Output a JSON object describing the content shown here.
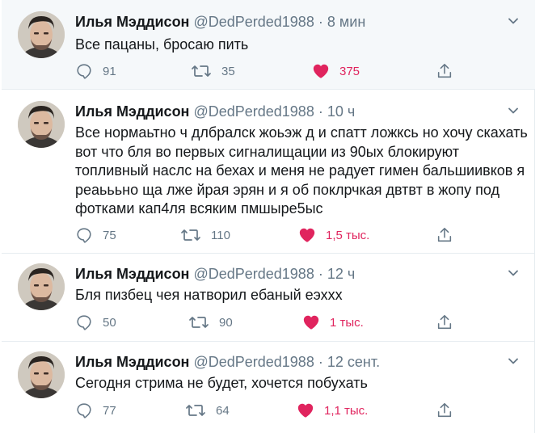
{
  "colors": {
    "like": "#e0245e",
    "muted": "#657786",
    "text": "#14171a",
    "highlight_bg": "#f5f8fa",
    "border": "#e6ecf0"
  },
  "icons": [
    "reply-icon",
    "retweet-icon",
    "heart-icon",
    "share-icon",
    "chevron-down-icon"
  ],
  "tweets": [
    {
      "name": "Илья Мэддисон",
      "handle": "@DedPerded1988",
      "sep": "·",
      "time": "8 мин",
      "text": "Все пацаны, бросаю пить",
      "replies": "91",
      "retweets": "35",
      "likes": "375"
    },
    {
      "name": "Илья Мэддисон",
      "handle": "@DedPerded1988",
      "sep": "·",
      "time": "10 ч",
      "text": "Все нормаьтно ч длбралск жоьэж д и спатт ложкс⁠ь но хочу скахать вот что бля во первых сигналищации из 90ых блокируют топливный наслс на бехах и меня не радует гимен бальшиивков я реаьььно ща лже йрая эрян  и я об поклрчкая двтвт в жопу под фотками кап4ля всяким пмшыре5ыс",
      "replies": "75",
      "retweets": "110",
      "likes": "1,5 тыс."
    },
    {
      "name": "Илья Мэддисон",
      "handle": "@DedPerded1988",
      "sep": "·",
      "time": "12 ч",
      "text": "Бля пизбец чея  натворил ебаный еэххх",
      "replies": "50",
      "retweets": "90",
      "likes": "1 тыс."
    },
    {
      "name": "Илья Мэддисон",
      "handle": "@DedPerded1988",
      "sep": "·",
      "time": "12 сент.",
      "text": "Сегодня стрима не будет, хочется побухать",
      "replies": "77",
      "retweets": "64",
      "likes": "1,1 тыс."
    }
  ]
}
